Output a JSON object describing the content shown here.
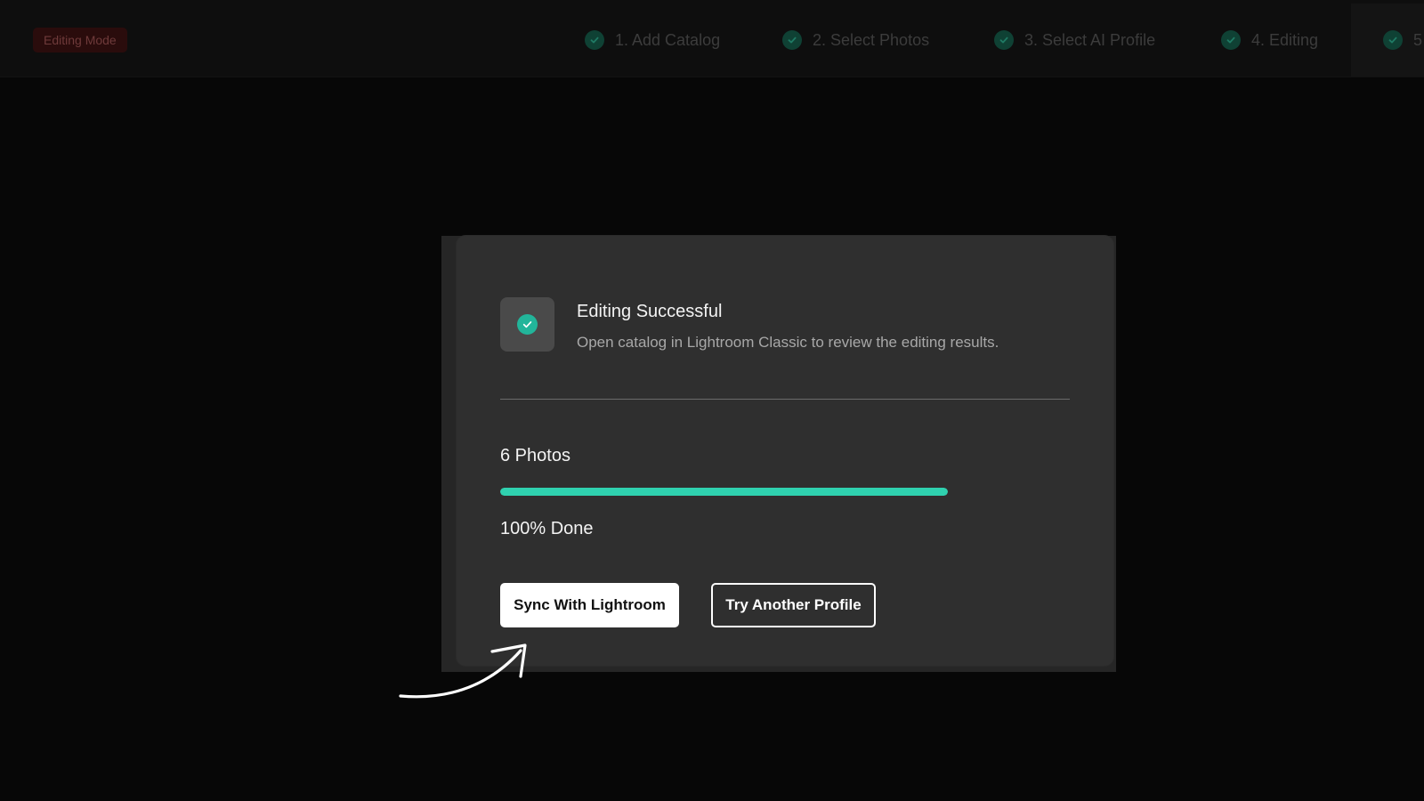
{
  "header": {
    "mode_badge": "Editing Mode",
    "steps": [
      {
        "label": "1. Add Catalog",
        "status": "complete"
      },
      {
        "label": "2. Select Photos",
        "status": "complete"
      },
      {
        "label": "3. Select AI Profile",
        "status": "complete"
      },
      {
        "label": "4. Editing",
        "status": "complete"
      },
      {
        "label": "5",
        "status": "complete"
      }
    ]
  },
  "dialog": {
    "icon": "check-circle-icon",
    "title": "Editing Successful",
    "subtitle": "Open catalog in Lightroom Classic to review the editing results.",
    "photo_count": "6 Photos",
    "progress_percent": 100,
    "progress_text": "100% Done",
    "primary_button": "Sync With Lightroom",
    "secondary_button": "Try Another Profile"
  },
  "annotation": {
    "icon": "curved-arrow-icon",
    "points_to": "Sync With Lightroom"
  },
  "colors": {
    "accent": "#2fd1af",
    "success_icon": "#22b59a",
    "dialog_bg": "#2f2f2f",
    "page_bg": "#070707",
    "mode_badge_bg": "#2a0c0c"
  }
}
